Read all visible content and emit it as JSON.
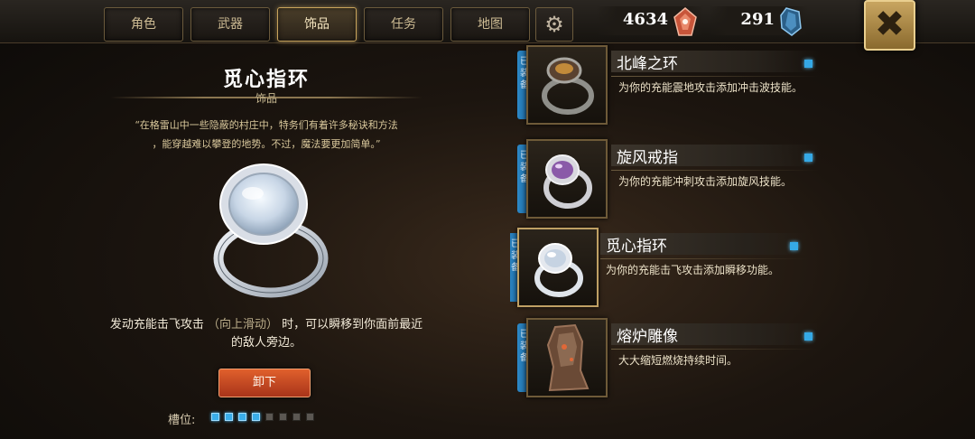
{
  "tabs": [
    {
      "label": "角色",
      "active": false
    },
    {
      "label": "武器",
      "active": false
    },
    {
      "label": "饰品",
      "active": true
    },
    {
      "label": "任务",
      "active": false
    },
    {
      "label": "地图",
      "active": false
    }
  ],
  "settings_icon": "gear-icon",
  "currency": {
    "coins": {
      "value": "4634",
      "icon": "shard-icon",
      "color": "#d0603a"
    },
    "gems": {
      "value": "291",
      "icon": "crystal-icon",
      "color": "#3a7fb0"
    }
  },
  "close_icon": "close-icon",
  "detail": {
    "title": "觅心指环",
    "type": "饰品",
    "quote_line1": "“在格雷山中一些隐蔽的村庄中，特务们有着许多秘诀和方法",
    "quote_line2": "，能穿越难以攀登的地势。不过，魔法要更加简单。”",
    "effect_part1": "发动充能击飞攻击",
    "effect_hint": "（向上滑动）",
    "effect_part2": "时，可以瞬移到你面前最近",
    "effect_line2": "的敌人旁边。",
    "unequip_label": "卸下",
    "slots_label": "槽位:",
    "slots_filled": 4,
    "slots_total": 8
  },
  "accessories": [
    {
      "name": "北峰之环",
      "desc": "为你的充能震地攻击添加冲击波技能。",
      "equipped_tag": "已装备",
      "selected": false
    },
    {
      "name": "旋风戒指",
      "desc": "为你的充能冲刺攻击添加旋风技能。",
      "equipped_tag": "已装备",
      "selected": false
    },
    {
      "name": "觅心指环",
      "desc": "为你的充能击飞攻击添加瞬移功能。",
      "equipped_tag": "已装备",
      "selected": true
    },
    {
      "name": "熔炉雕像",
      "desc": "大大缩短燃烧持续时间。",
      "equipped_tag": "已装备",
      "selected": false
    }
  ],
  "colors": {
    "accent_gold": "#c9a45c",
    "equip_blue": "#35a9e6",
    "unequip_orange": "#e0602c"
  }
}
